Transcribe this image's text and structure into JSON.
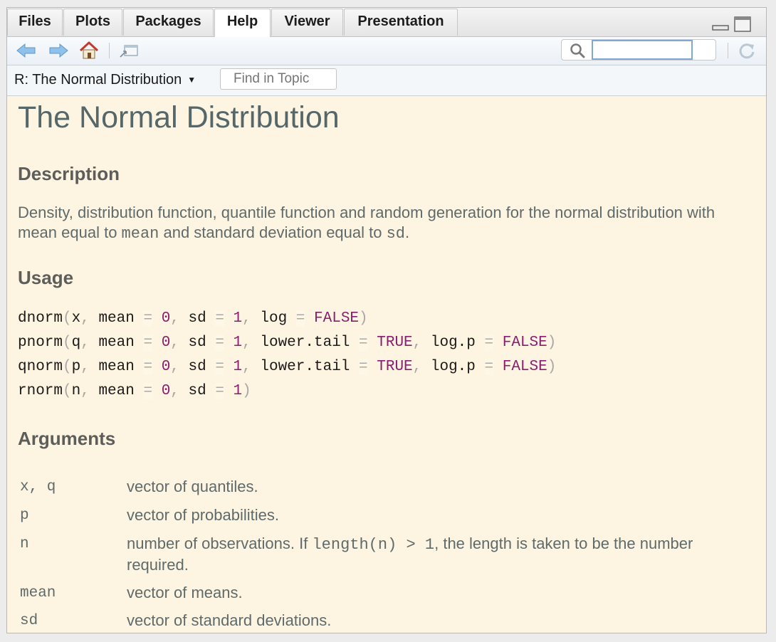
{
  "tabs": [
    "Files",
    "Plots",
    "Packages",
    "Help",
    "Viewer",
    "Presentation"
  ],
  "active_tab": "Help",
  "search": {
    "value": ""
  },
  "topic": {
    "label": "R: The Normal Distribution",
    "find_placeholder": "Find in Topic"
  },
  "doc": {
    "title": "The Normal Distribution",
    "description_heading": "Description",
    "description": {
      "t1": "Density, distribution function, quantile function and random generation for the normal distribution with mean equal to ",
      "c1": "mean",
      "t2": " and standard deviation equal to ",
      "c2": "sd",
      "t3": "."
    },
    "usage_heading": "Usage",
    "usage": [
      {
        "fn": "dnorm",
        "a1": "x",
        "mean": "0",
        "sd": "1",
        "extra": "log",
        "extra_val": "FALSE"
      },
      {
        "fn": "pnorm",
        "a1": "q",
        "mean": "0",
        "sd": "1",
        "tail": "lower.tail",
        "tail_val": "TRUE",
        "logp": "log.p",
        "logp_val": "FALSE"
      },
      {
        "fn": "qnorm",
        "a1": "p",
        "mean": "0",
        "sd": "1",
        "tail": "lower.tail",
        "tail_val": "TRUE",
        "logp": "log.p",
        "logp_val": "FALSE"
      },
      {
        "fn": "rnorm",
        "a1": "n",
        "mean": "0",
        "sd": "1"
      }
    ],
    "arguments_heading": "Arguments",
    "arguments": [
      {
        "name": "x, q",
        "text": "vector of quantiles."
      },
      {
        "name": "p",
        "text": "vector of probabilities."
      },
      {
        "name": "n",
        "t1": "number of observations. If ",
        "code": "length(n) > 1",
        "t2": ", the length is taken to be the number required."
      },
      {
        "name": "mean",
        "text": "vector of means."
      },
      {
        "name": "sd",
        "text": "vector of standard deviations."
      }
    ]
  }
}
